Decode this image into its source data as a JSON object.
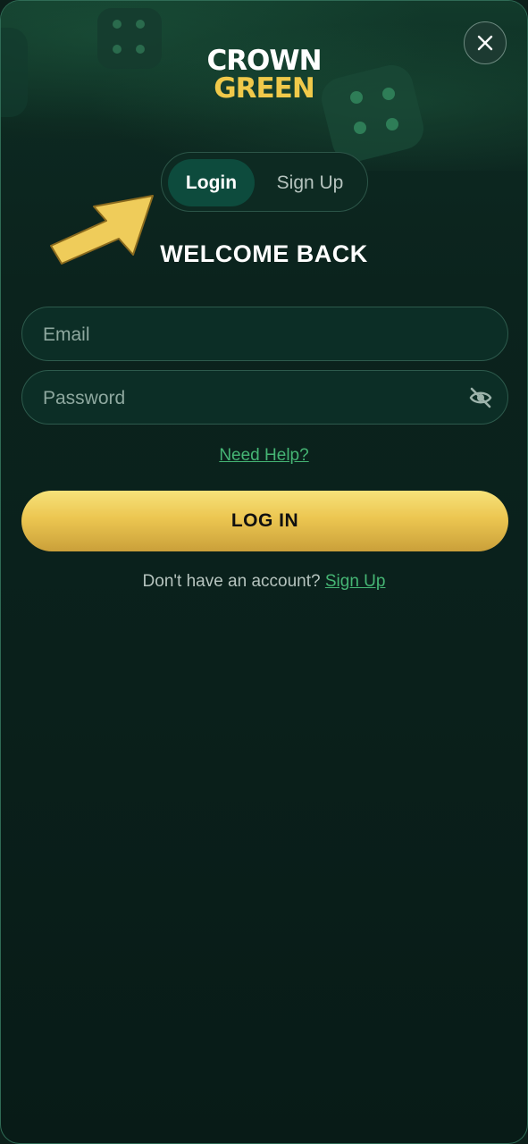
{
  "brand": {
    "line1": "CROWN",
    "line2": "GREEN",
    "colors": {
      "white": "#ffffff",
      "gold": "#f0c94a"
    }
  },
  "close": {
    "icon": "close-icon"
  },
  "tabs": [
    {
      "label": "Login",
      "active": true
    },
    {
      "label": "Sign Up",
      "active": false
    }
  ],
  "pointer": {
    "icon": "arrow-pointer-icon",
    "color": "#efcc5a"
  },
  "heading": "WELCOME BACK",
  "form": {
    "email": {
      "placeholder": "Email",
      "value": ""
    },
    "password": {
      "placeholder": "Password",
      "value": "",
      "toggle_icon": "eye-slash-icon"
    },
    "help_link": "Need Help?",
    "submit_label": "LOG IN"
  },
  "footer": {
    "prompt": "Don't have an account?",
    "link": "Sign Up"
  },
  "colors": {
    "background": "#0b231d",
    "accent_green": "#45b574",
    "active_tab": "#0d4b3d",
    "button_gold": "#ecc651"
  }
}
